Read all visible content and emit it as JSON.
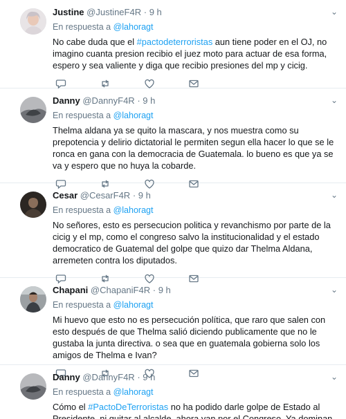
{
  "feed": {
    "tweets": [
      {
        "name": "Justine",
        "handle": "@JustineF4R",
        "dot": "·",
        "time": "9 h",
        "reply_prefix": "En respuesta a",
        "reply_to": "@lahoragt",
        "text_a": "No cabe duda que el ",
        "hashtag": "#pactodeterroristas",
        "text_b": " aun tiene poder en el OJ, no imagino cuanta presion recibio el juez moto para actuar de esa forma, espero y sea valiente y diga que recibio presiones del mp y cicig."
      },
      {
        "name": "Danny",
        "handle": "@DannyF4R",
        "dot": "·",
        "time": "9 h",
        "reply_prefix": "En respuesta a",
        "reply_to": "@lahoragt",
        "text": "Thelma aldana ya se quito la mascara, y nos muestra como su prepotencia y delirio dictatorial le permiten segun ella hacer lo que se le ronca en gana con la democracia de Guatemala. lo bueno es que ya se va y espero que no huya la cobarde."
      },
      {
        "name": "Cesar",
        "handle": "@CesarF4R",
        "dot": "·",
        "time": "9 h",
        "reply_prefix": "En respuesta a",
        "reply_to": "@lahoragt",
        "text": "No señores, esto es persecucion politica y revanchismo por parte de la cicig y el mp, como el congreso salvo la institucionalidad y el estado democratico de Guatemal del golpe que quizo dar Thelma Aldana, arremeten contra los diputados."
      },
      {
        "name": "Chapani",
        "handle": "@ChapaniF4R",
        "dot": "·",
        "time": "9 h",
        "reply_prefix": "En respuesta a",
        "reply_to": "@lahoragt",
        "text": "Mi huevo que esto no es persecución política, que raro que salen con esto después de que Thelma salió diciendo publicamente que no le gustaba la junta directiva. o sea que en guatemala gobierna solo los amigos de Thelma e Ivan?"
      },
      {
        "name": "Danny",
        "handle": "@DannyF4R",
        "dot": "·",
        "time": "9 h",
        "reply_prefix": "En respuesta a",
        "reply_to": "@lahoragt",
        "text_a": "Cómo el ",
        "hashtag": "#PactoDeTerroristas",
        "text_b": " no ha podido darle golpe de Estado al Presidente, ni quitar al alcalde, ahora van por el Congreso. Ya dominan la \"justicia\" que de"
      }
    ]
  },
  "colors": {
    "link": "#1da1f2",
    "secondary_text": "#657786",
    "divider": "#e6ecf0"
  },
  "icons": [
    "chevron-down-icon",
    "reply-icon",
    "retweet-icon",
    "like-icon",
    "message-icon"
  ]
}
